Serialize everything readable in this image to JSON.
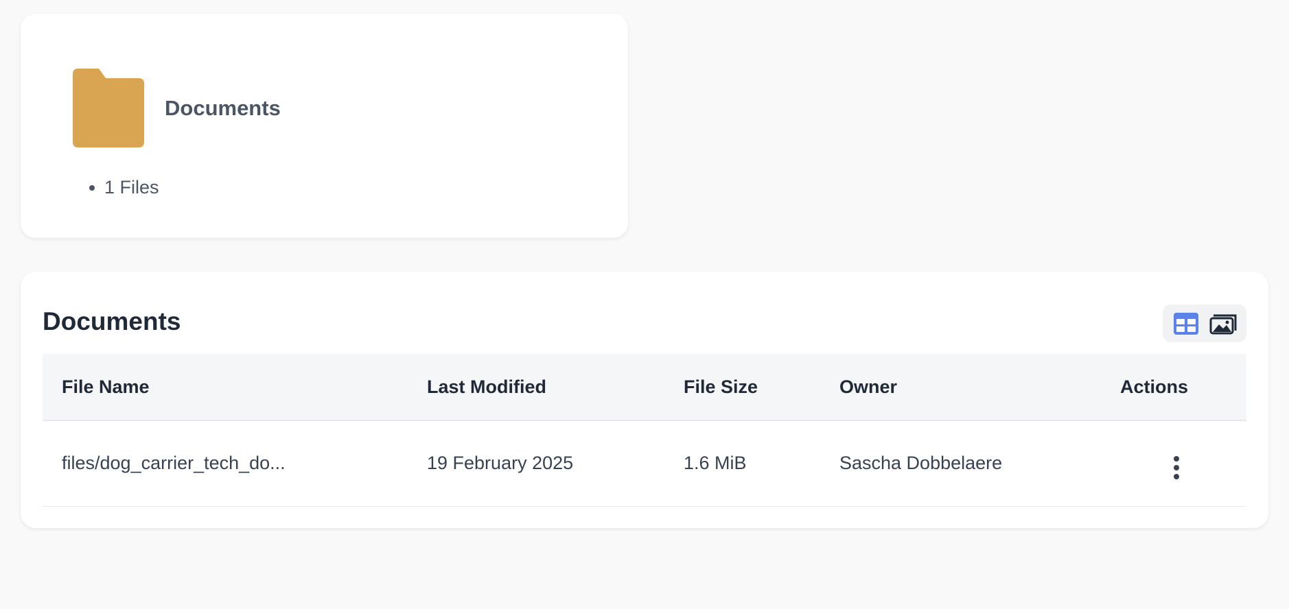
{
  "folder_card": {
    "title": "Documents",
    "file_count": "1 Files",
    "icon": "folder-icon",
    "icon_color": "#d9a552"
  },
  "documents_section": {
    "title": "Documents",
    "view_toggle": {
      "table_icon": "table-view-icon",
      "table_color": "#5b82e8",
      "gallery_icon": "gallery-view-icon",
      "gallery_color": "#1f2937"
    },
    "table": {
      "columns": [
        "File Name",
        "Last Modified",
        "File Size",
        "Owner",
        "Actions"
      ],
      "rows": [
        {
          "file_name": "files/dog_carrier_tech_do...",
          "last_modified": "19 February 2025",
          "file_size": "1.6 MiB",
          "owner": "Sascha Dobbelaere",
          "actions_icon": "more-vertical-icon"
        }
      ]
    }
  }
}
